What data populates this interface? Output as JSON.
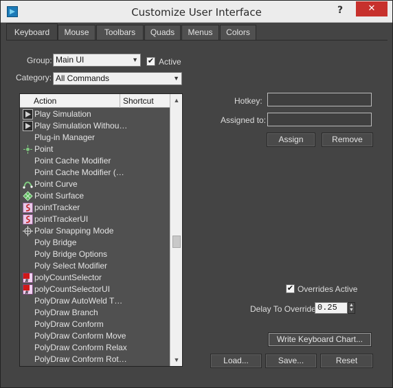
{
  "window": {
    "title": "Customize User Interface",
    "help_label": "?",
    "close_label": "✕"
  },
  "tabs": [
    {
      "label": "Keyboard",
      "active": true
    },
    {
      "label": "Mouse",
      "active": false
    },
    {
      "label": "Toolbars",
      "active": false
    },
    {
      "label": "Quads",
      "active": false
    },
    {
      "label": "Menus",
      "active": false
    },
    {
      "label": "Colors",
      "active": false
    }
  ],
  "group": {
    "label": "Group:",
    "value": "Main UI"
  },
  "active": {
    "label": "Active",
    "checked": true
  },
  "category": {
    "label": "Category:",
    "value": "All Commands"
  },
  "action_list": {
    "columns": {
      "action": "Action",
      "shortcut": "Shortcut"
    },
    "scroll_fraction": 0.55,
    "rows": [
      {
        "label": "Play Simulation",
        "icon": "play-icon"
      },
      {
        "label": "Play Simulation Withou…",
        "icon": "play-icon"
      },
      {
        "label": "Plug-in Manager",
        "icon": ""
      },
      {
        "label": "Point",
        "icon": "point-icon"
      },
      {
        "label": "Point Cache Modifier",
        "icon": ""
      },
      {
        "label": "Point Cache Modifier (…",
        "icon": ""
      },
      {
        "label": "Point Curve",
        "icon": "curve-icon"
      },
      {
        "label": "Point Surface",
        "icon": "surface-icon"
      },
      {
        "label": "pointTracker",
        "icon": "script-icon"
      },
      {
        "label": "pointTrackerUI",
        "icon": "script-icon"
      },
      {
        "label": "Polar Snapping Mode",
        "icon": "crosshair-icon"
      },
      {
        "label": "Poly Bridge",
        "icon": ""
      },
      {
        "label": "Poly Bridge Options",
        "icon": ""
      },
      {
        "label": "Poly Select Modifier",
        "icon": ""
      },
      {
        "label": "polyCountSelector",
        "icon": "polycount-icon"
      },
      {
        "label": "polyCountSelectorUI",
        "icon": "polycount-icon"
      },
      {
        "label": "PolyDraw AutoWeld T…",
        "icon": ""
      },
      {
        "label": "PolyDraw Branch",
        "icon": ""
      },
      {
        "label": "PolyDraw Conform",
        "icon": ""
      },
      {
        "label": "PolyDraw Conform Move",
        "icon": ""
      },
      {
        "label": "PolyDraw Conform Relax",
        "icon": ""
      },
      {
        "label": "PolyDraw Conform Rot…",
        "icon": ""
      }
    ]
  },
  "hotkey": {
    "label": "Hotkey:",
    "value": ""
  },
  "assigned_to": {
    "label": "Assigned to:",
    "value": ""
  },
  "buttons": {
    "assign": "Assign",
    "remove": "Remove",
    "write_chart": "Write Keyboard Chart...",
    "load": "Load...",
    "save": "Save...",
    "reset": "Reset"
  },
  "overrides_active": {
    "label": "Overrides Active",
    "checked": true
  },
  "delay": {
    "label": "Delay To Override:",
    "value": "0.25"
  }
}
